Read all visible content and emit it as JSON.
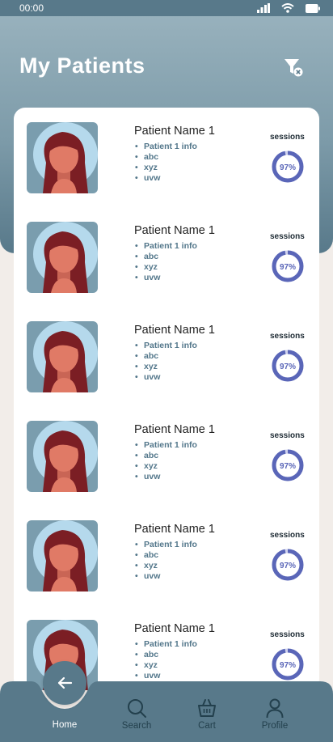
{
  "status_bar": {
    "time": "00:00"
  },
  "header": {
    "title": "My Patients"
  },
  "patients": [
    {
      "name": "Patient Name 1",
      "info": [
        "Patient 1 info",
        "abc",
        "xyz",
        "uvw"
      ],
      "sessions_label": "sessions",
      "progress_text": "97%",
      "progress": 0.97
    },
    {
      "name": "Patient Name 1",
      "info": [
        "Patient 1 info",
        "abc",
        "xyz",
        "uvw"
      ],
      "sessions_label": "sessions",
      "progress_text": "97%",
      "progress": 0.97
    },
    {
      "name": "Patient Name 1",
      "info": [
        "Patient 1 info",
        "abc",
        "xyz",
        "uvw"
      ],
      "sessions_label": "sessions",
      "progress_text": "97%",
      "progress": 0.97
    },
    {
      "name": "Patient Name 1",
      "info": [
        "Patient 1 info",
        "abc",
        "xyz",
        "uvw"
      ],
      "sessions_label": "sessions",
      "progress_text": "97%",
      "progress": 0.97
    },
    {
      "name": "Patient Name 1",
      "info": [
        "Patient 1 info",
        "abc",
        "xyz",
        "uvw"
      ],
      "sessions_label": "sessions",
      "progress_text": "97%",
      "progress": 0.97
    },
    {
      "name": "Patient Name 1",
      "info": [
        "Patient 1 info",
        "abc",
        "xyz",
        "uvw"
      ],
      "sessions_label": "sessions",
      "progress_text": "97%",
      "progress": 0.97
    }
  ],
  "nav": {
    "home": "Home",
    "search": "Search",
    "cart": "Cart",
    "profile": "Profile"
  },
  "colors": {
    "primary": "#58798a",
    "header_light": "#9bb4bf",
    "ring": "#5a66b8",
    "avatar_bg": "#7a9dae",
    "info_text": "#52768a"
  },
  "icons": {
    "filter": "filter-clear-icon",
    "home_button": "arrow-left-icon",
    "search": "search-icon",
    "cart": "basket-icon",
    "profile": "user-icon"
  }
}
